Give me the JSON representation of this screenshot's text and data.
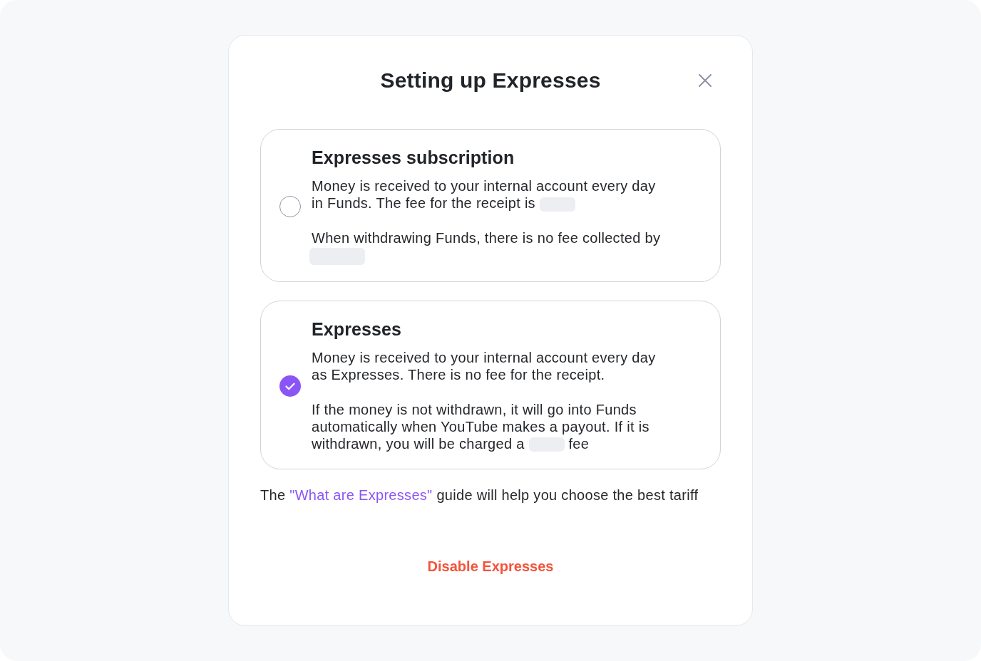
{
  "dialog": {
    "title": "Setting up Expresses"
  },
  "options": [
    {
      "title": "Expresses subscription",
      "selected": false,
      "paragraphs": [
        {
          "parts": [
            {
              "kind": "text",
              "text": "Money is received to your internal account every day in Funds. The fee for the receipt is"
            },
            {
              "kind": "blank",
              "wide": false
            }
          ]
        },
        {
          "parts": [
            {
              "kind": "text",
              "text": "When withdrawing Funds, there is no fee collected by"
            },
            {
              "kind": "blank",
              "wide": true
            }
          ]
        }
      ]
    },
    {
      "title": "Expresses",
      "selected": true,
      "paragraphs": [
        {
          "parts": [
            {
              "kind": "text",
              "text": "Money is received to your internal account every day as Expresses. There is no fee for the receipt."
            }
          ]
        },
        {
          "parts": [
            {
              "kind": "text",
              "text": "If the money is not withdrawn, it will go into Funds automatically when YouTube makes a payout. If it is withdrawn, you will be charged a"
            },
            {
              "kind": "blank",
              "wide": false
            },
            {
              "kind": "text",
              "text": "fee"
            }
          ]
        }
      ]
    }
  ],
  "guide_note": {
    "before": "The",
    "link": "\"What are Expresses\"",
    "after": "guide will help you choose the best tariff"
  },
  "disable_button": "Disable Expresses"
}
